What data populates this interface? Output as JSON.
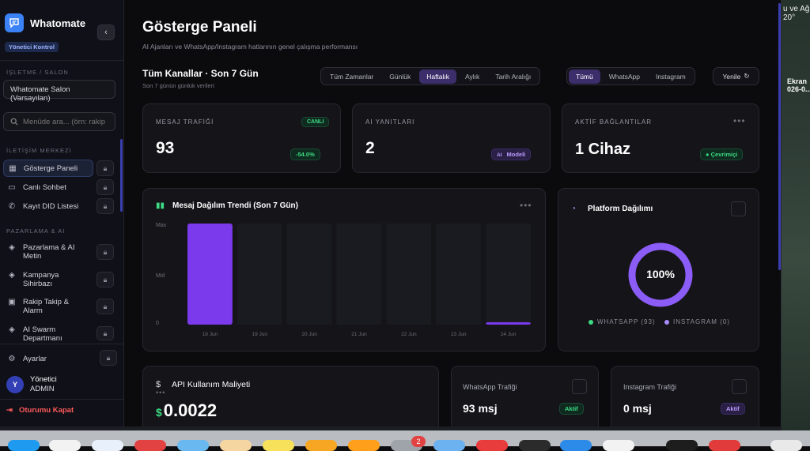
{
  "sidebar": {
    "app_name": "Whatomate",
    "role_badge": "Yönetici Kontrol",
    "section_business": "İŞLETME / SALON",
    "salon_select": "Whatomate Salon (Varsayılan)",
    "search_placeholder": "Menüde ara... (örn: rakip",
    "section_communication": "İLETİŞİM MERKEZİ",
    "section_marketing": "PAZARLAMA & AI",
    "items": [
      {
        "label": "Gösterge Paneli",
        "icon": "grid-icon"
      },
      {
        "label": "Canlı Sohbet",
        "icon": "chat-icon"
      },
      {
        "label": "Kayıt DID Listesi",
        "icon": "phone-icon"
      },
      {
        "label": "Pazarlama & AI Metin",
        "icon": "layers-icon"
      },
      {
        "label": "Kampanya Sihirbazı",
        "icon": "layers-icon"
      },
      {
        "label": "Rakip Takip & Alarm",
        "icon": "id-card-icon"
      },
      {
        "label": "AI Swarm Departmanı",
        "icon": "layers-icon"
      }
    ],
    "settings_label": "Ayarlar",
    "user": {
      "initial": "Y",
      "name": "Yönetici",
      "role": "ADMIN"
    },
    "logout_label": "Oturumu Kapat"
  },
  "header": {
    "title": "Gösterge Paneli",
    "subtitle": "AI Ajanları ve WhatsApp/Instagram hatlarının genel çalışma performansı"
  },
  "filters": {
    "title": "Tüm Kanallar · Son 7 Gün",
    "subtitle": "Son 7 günün günlük verileri",
    "time_options": [
      "Tüm Zamanlar",
      "Günlük",
      "Haftalık",
      "Aylık",
      "Tarih Aralığı"
    ],
    "time_selected": "Haftalık",
    "channel_options": [
      "Tümü",
      "WhatsApp",
      "Instagram"
    ],
    "channel_selected": "Tümü",
    "refresh_label": "Yenile"
  },
  "stats": {
    "traffic": {
      "label": "MESAJ TRAFİĞİ",
      "value": "93",
      "badge": "CANLI",
      "delta": "-54.0%"
    },
    "ai_replies": {
      "label": "AI YANITLARI",
      "value": "2",
      "badge_prefix": "AI",
      "badge": "Modeli"
    },
    "connections": {
      "label": "AKTİF BAĞLANTILAR",
      "value": "1 Cihaz",
      "badge": "● Çevrimiçi"
    }
  },
  "trend_chart": {
    "title": "Mesaj Dağılım Trendi (Son 7 Gün)",
    "y_ticks": [
      "Max",
      "Mid",
      "0"
    ]
  },
  "chart_data": {
    "type": "bar",
    "title": "Mesaj Dağılım Trendi (Son 7 Gün)",
    "categories": [
      "18 Jun",
      "19 Jun",
      "20 Jun",
      "21 Jun",
      "22 Jun",
      "23 Jun",
      "24 Jun"
    ],
    "values": [
      91,
      0,
      0,
      0,
      0,
      0,
      2
    ],
    "ylabel": "",
    "xlabel": "",
    "color": "#7c3aed"
  },
  "platform": {
    "title": "Platform Dağılımı",
    "percent": "100%",
    "whatsapp_label": "WHATSAPP (93)",
    "instagram_label": "INSTAGRAM (0)",
    "ring_color": "#8b5cf6",
    "whatsapp_color": "#3ddc84",
    "instagram_color": "#a78bfa"
  },
  "cost": {
    "title": "API Kullanım Maliyeti",
    "currency_icon": "$",
    "value": "0.0022"
  },
  "whatsapp_traffic": {
    "title": "WhatsApp Trafiği",
    "value": "93 msj",
    "badge": "Aktif"
  },
  "instagram_traffic": {
    "title": "Instagram Trafiği",
    "value": "0 msj",
    "badge": "Aktif"
  },
  "desktop": {
    "top_text": "u ve Ağı",
    "top_sub": "20°",
    "label1": "Ekran",
    "label2": "026-0..."
  },
  "dock": {
    "badge": "2"
  }
}
